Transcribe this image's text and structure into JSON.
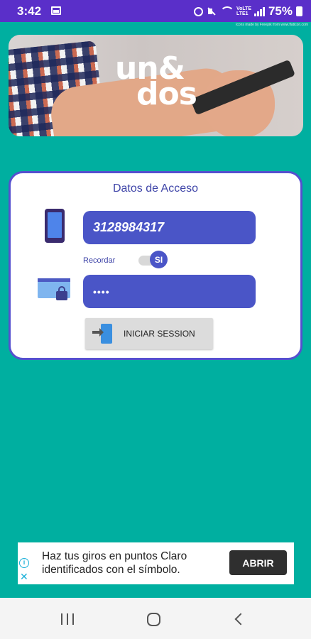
{
  "status_bar": {
    "time": "3:42",
    "network_label_top": "VoLTE",
    "network_label_bottom": "LTE1",
    "battery": "75%"
  },
  "attribution": "Icons made by Freepik from www.flaticon.com",
  "hero": {
    "logo_line1": "un&",
    "logo_line2": "dos"
  },
  "login": {
    "title": "Datos de Acceso",
    "phone_value": "3128984317",
    "remember_label": "Recordar",
    "toggle_label": "SI",
    "password_value": "••••",
    "submit_label": "INICIAR SESSION"
  },
  "ad": {
    "text": "Haz tus giros en puntos Claro identificados con el símbolo.",
    "button_label": "ABRIR",
    "info_icon": "i",
    "close_icon": "✕"
  },
  "colors": {
    "background": "#00AFA0",
    "status_bar": "#5A2FC9",
    "accent": "#4A55C7",
    "card_border": "#5550CF"
  }
}
